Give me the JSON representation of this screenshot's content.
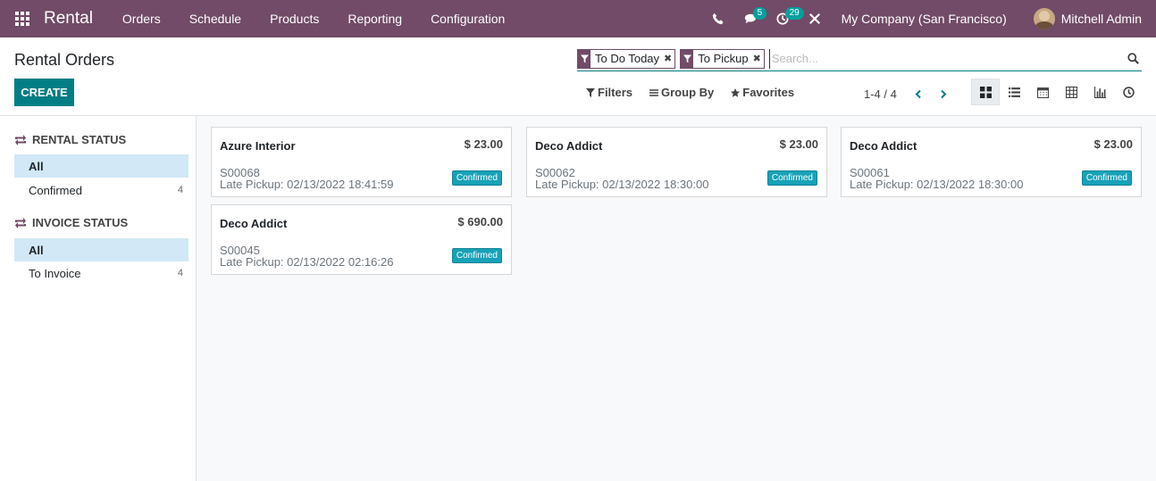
{
  "navbar": {
    "brand": "Rental",
    "menu": [
      "Orders",
      "Schedule",
      "Products",
      "Reporting",
      "Configuration"
    ],
    "messages_count": "5",
    "activities_count": "29",
    "company": "My Company (San Francisco)",
    "user": "Mitchell Admin",
    "color": "#714b67"
  },
  "control": {
    "title": "Rental Orders",
    "create_label": "CREATE",
    "facets": [
      "To Do Today",
      "To Pickup"
    ],
    "search_placeholder": "Search...",
    "filters_label": "Filters",
    "groupby_label": "Group By",
    "favorites_label": "Favorites",
    "pager": "1-4 / 4"
  },
  "sidebar": {
    "rental_status": {
      "header": "Rental Status",
      "items": [
        {
          "label": "All",
          "count": ""
        },
        {
          "label": "Confirmed",
          "count": "4"
        }
      ]
    },
    "invoice_status": {
      "header": "Invoice Status",
      "items": [
        {
          "label": "All",
          "count": ""
        },
        {
          "label": "To Invoice",
          "count": "4"
        }
      ]
    }
  },
  "cards": [
    {
      "name": "Azure Interior",
      "amount": "$ 23.00",
      "ref": "S00068",
      "pickup_label": "Late Pickup:",
      "pickup_date": "02/13/2022 18:41:59",
      "status": "Confirmed"
    },
    {
      "name": "Deco Addict",
      "amount": "$ 23.00",
      "ref": "S00062",
      "pickup_label": "Late Pickup:",
      "pickup_date": "02/13/2022 18:30:00",
      "status": "Confirmed"
    },
    {
      "name": "Deco Addict",
      "amount": "$ 23.00",
      "ref": "S00061",
      "pickup_label": "Late Pickup:",
      "pickup_date": "02/13/2022 18:30:00",
      "status": "Confirmed"
    },
    {
      "name": "Deco Addict",
      "amount": "$ 690.00",
      "ref": "S00045",
      "pickup_label": "Late Pickup:",
      "pickup_date": "02/13/2022 02:16:26",
      "status": "Confirmed"
    }
  ]
}
